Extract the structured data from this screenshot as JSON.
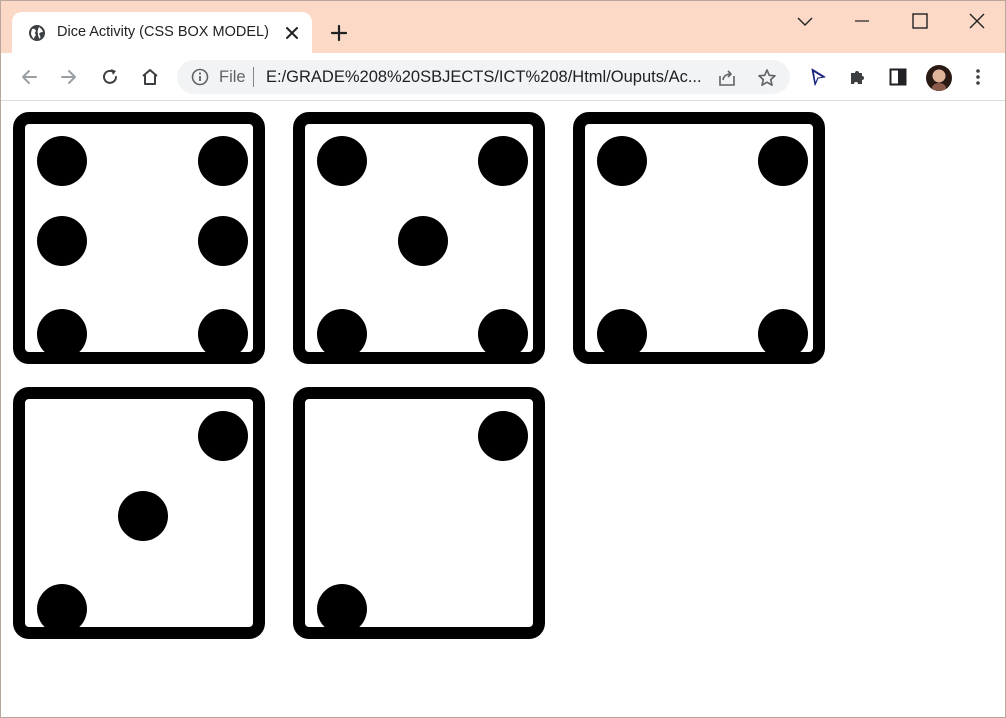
{
  "browser": {
    "tab_title": "Dice Activity (CSS BOX MODEL)",
    "address_scheme": "File",
    "address_url": "E:/GRADE%208%20SBJECTS/ICT%208/Html/Ouputs/Ac..."
  },
  "icons": {
    "tab_favicon": "globe-icon",
    "tab_close": "close-icon",
    "new_tab": "plus-icon",
    "tab_search": "chevron-down-icon",
    "minimize": "minimize-icon",
    "maximize": "maximize-icon",
    "close_window": "close-icon",
    "back": "arrow-left-icon",
    "forward": "arrow-right-icon",
    "reload": "reload-icon",
    "home": "home-icon",
    "site_info": "info-icon",
    "share": "share-icon",
    "bookmark": "star-icon",
    "extension_cursor": "cursor-icon",
    "extensions": "puzzle-icon",
    "side_panel": "side-panel-icon",
    "menu": "kebab-menu-icon"
  },
  "colors": {
    "titlebar": "#fbd9c6",
    "die_border": "#000000",
    "pip": "#000000"
  },
  "dice": [
    {
      "face": 6
    },
    {
      "face": 5
    },
    {
      "face": 4
    },
    {
      "face": 3
    },
    {
      "face": 2
    }
  ]
}
